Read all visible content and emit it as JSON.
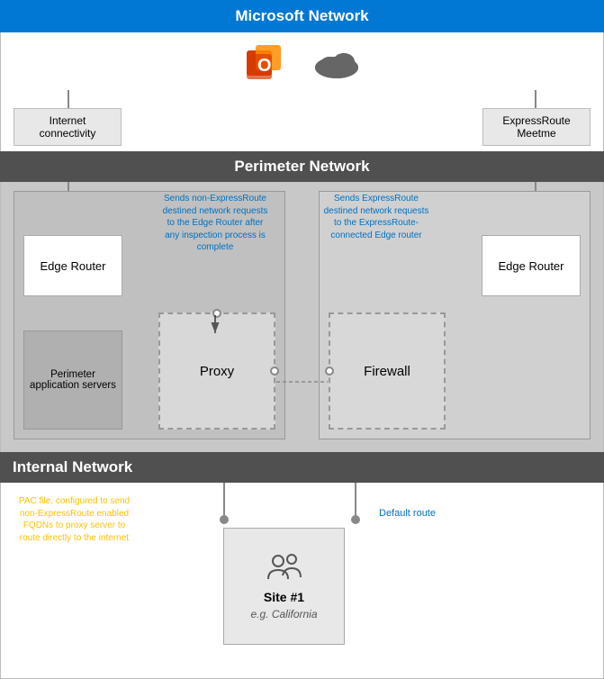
{
  "header": {
    "ms_network": "Microsoft Network",
    "perimeter_network": "Perimeter Network",
    "internal_network": "Internal Network"
  },
  "labels": {
    "internet_connectivity": "Internet connectivity",
    "expressroute_meetme": "ExpressRoute Meetme",
    "edge_router_left": "Edge Router",
    "edge_router_right": "Edge Router",
    "perimeter_app_servers": "Perimeter application servers",
    "proxy": "Proxy",
    "firewall": "Firewall",
    "site1_title": "Site #1",
    "site1_sub": "e.g. California"
  },
  "annotations": {
    "sends_non_express": "Sends non-ExpressRoute destined network requests to the Edge Router after any inspection process is complete",
    "sends_express": "Sends ExpressRoute destined network requests to the ExpressRoute-connected Edge router",
    "pac_file": "PAC file, configured to send non-ExpressRoute enabled FQDNs to proxy server to route directly to the internet",
    "default_route": "Default route"
  },
  "colors": {
    "ms_header_bg": "#0078d4",
    "section_header_bg": "#505050",
    "annotation_blue": "#0070c0",
    "annotation_yellow": "#ffc000",
    "perimeter_bg": "#d0d0d0",
    "box_bg": "#ffffff",
    "grey_box_bg": "#c0c0c0"
  }
}
